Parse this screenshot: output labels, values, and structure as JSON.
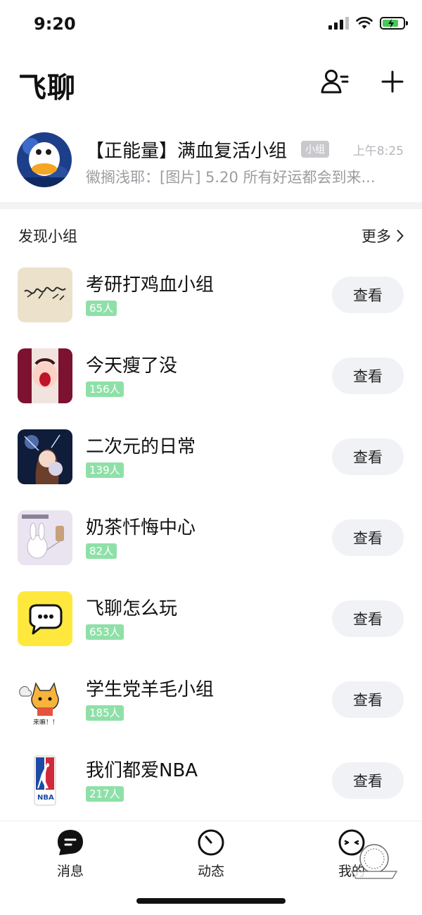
{
  "status_bar": {
    "time": "9:20"
  },
  "header": {
    "title": "飞聊"
  },
  "pinned_chat": {
    "name": "【正能量】满血复活小组",
    "tag": "小组",
    "time": "上午8:25",
    "preview": "徽搁浅耶：[图片] 5.20 所有好运都会到来..."
  },
  "discover": {
    "title": "发现小组",
    "more_label": "更多",
    "groups": [
      {
        "name": "考研打鸡血小组",
        "members": "65人",
        "button": "查看"
      },
      {
        "name": "今天瘦了没",
        "members": "156人",
        "button": "查看"
      },
      {
        "name": "二次元的日常",
        "members": "139人",
        "button": "查看"
      },
      {
        "name": "奶茶忏悔中心",
        "members": "82人",
        "button": "查看"
      },
      {
        "name": "飞聊怎么玩",
        "members": "653人",
        "button": "查看"
      },
      {
        "name": "学生党羊毛小组",
        "members": "185人",
        "button": "查看"
      },
      {
        "name": "我们都爱NBA",
        "members": "217人",
        "button": "查看"
      }
    ]
  },
  "tab_bar": {
    "tabs": [
      {
        "label": "消息",
        "icon": "chat-bubble-icon"
      },
      {
        "label": "动态",
        "icon": "clock-icon"
      },
      {
        "label": "我的",
        "icon": "face-icon"
      }
    ]
  },
  "colors": {
    "member_badge": "#8fe0a8",
    "view_button_bg": "#f1f2f5",
    "separator": "#f2f3f5"
  }
}
